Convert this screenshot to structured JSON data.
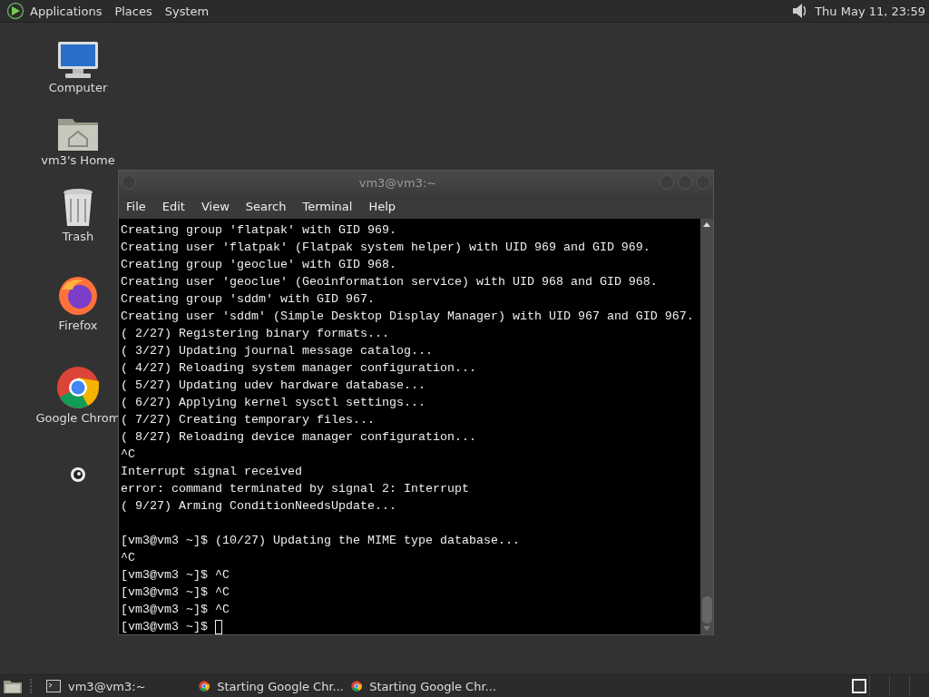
{
  "top_panel": {
    "menus": [
      "Applications",
      "Places",
      "System"
    ],
    "clock": "Thu May 11, 23:59"
  },
  "desktop_icons": [
    {
      "label": "Computer",
      "kind": "computer"
    },
    {
      "label": "vm3's Home",
      "kind": "home"
    },
    {
      "label": "Trash",
      "kind": "trash"
    },
    {
      "label": "Firefox",
      "kind": "firefox"
    },
    {
      "label": "Google Chrom",
      "kind": "chrome"
    },
    {
      "kind": "disc"
    }
  ],
  "window": {
    "title": "vm3@vm3:~",
    "menu": [
      "File",
      "Edit",
      "View",
      "Search",
      "Terminal",
      "Help"
    ],
    "lines": [
      {
        "text": "Creating group 'flatpak' with GID 969."
      },
      {
        "text": "Creating user 'flatpak' (Flatpak system helper) with UID 969 and GID 969."
      },
      {
        "text": "Creating group 'geoclue' with GID 968."
      },
      {
        "text": "Creating user 'geoclue' (Geoinformation service) with UID 968 and GID 968."
      },
      {
        "text": "Creating group 'sddm' with GID 967."
      },
      {
        "text": "Creating user 'sddm' (Simple Desktop Display Manager) with UID 967 and GID 967."
      },
      {
        "text": "( 2/27) Registering binary formats..."
      },
      {
        "text": "( 3/27) Updating journal message catalog..."
      },
      {
        "text": "( 4/27) Reloading system manager configuration..."
      },
      {
        "text": "( 5/27) Updating udev hardware database..."
      },
      {
        "text": "( 6/27) Applying kernel sysctl settings..."
      },
      {
        "text": "( 7/27) Creating temporary files..."
      },
      {
        "text": "( 8/27) Reloading device manager configuration..."
      },
      {
        "text": "^C"
      },
      {
        "text": "Interrupt signal received"
      },
      {
        "text": "error: command terminated by signal 2: Interrupt"
      },
      {
        "text": "( 9/27) Arming ConditionNeedsUpdate..."
      },
      {
        "text": "[vm3@vm3 ~]$ (10/27) Updating the MIME type database...",
        "space_before": true
      },
      {
        "text": "^C"
      },
      {
        "text": "[vm3@vm3 ~]$ ^C"
      },
      {
        "text": "[vm3@vm3 ~]$ ^C"
      },
      {
        "text": "[vm3@vm3 ~]$ ^C"
      },
      {
        "text": "[vm3@vm3 ~]$",
        "cursor": true
      }
    ]
  },
  "taskbar": {
    "tasks": [
      {
        "label": "vm3@vm3:~",
        "kind": "terminal"
      },
      {
        "label": "Starting Google Chr...",
        "kind": "chrome"
      },
      {
        "label": "Starting Google Chr...",
        "kind": "chrome"
      }
    ],
    "workspaces": [
      {
        "selected": true
      },
      {
        "selected": false
      },
      {
        "selected": false
      },
      {
        "selected": false
      }
    ]
  }
}
